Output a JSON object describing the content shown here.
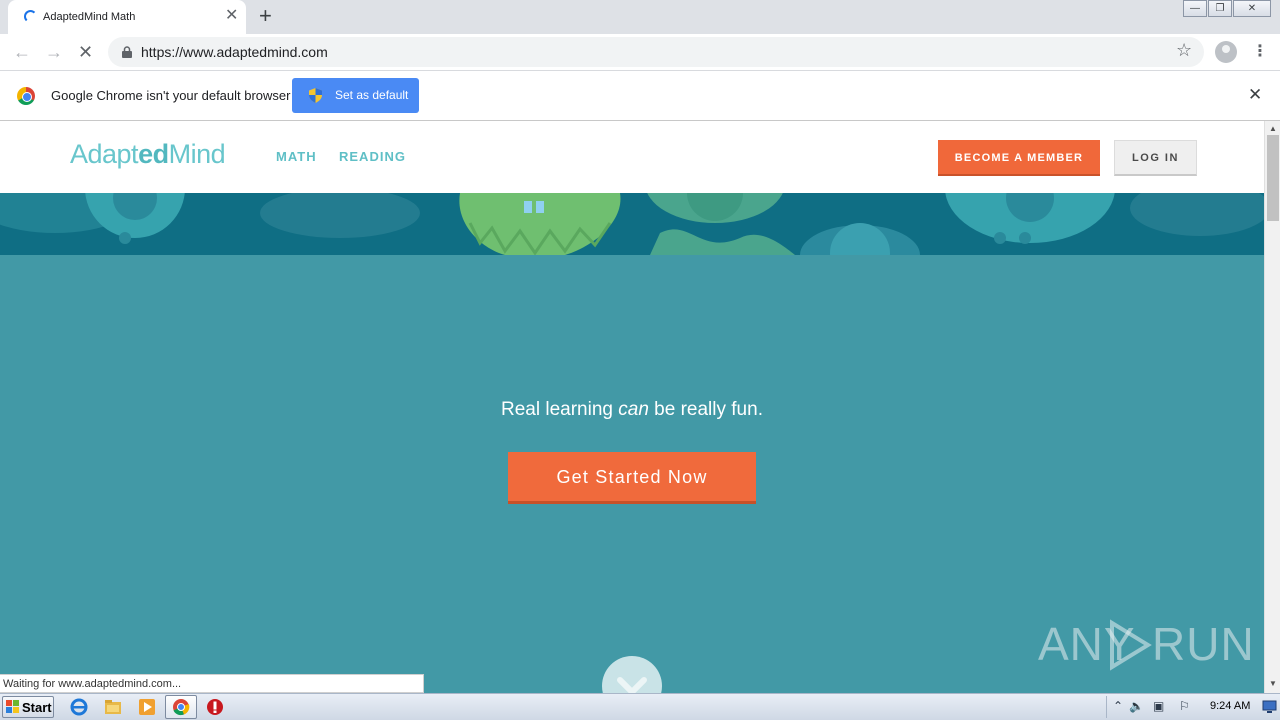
{
  "browser": {
    "tab": {
      "title": "AdaptedMind Math",
      "close_glyph": "✕"
    },
    "new_tab_glyph": "+",
    "window_controls": {
      "minimize": "—",
      "restore": "❐",
      "close": "✕"
    },
    "address": {
      "url": "https://www.adaptedmind.com"
    },
    "nav_glyphs": {
      "back": "←",
      "forward": "→",
      "stop": "✕",
      "star": "☆",
      "menu": "⋮"
    },
    "infobar": {
      "message": "Google Chrome isn't your default browser",
      "button_label": "Set as default",
      "close_glyph": "✕"
    },
    "status_text": "Waiting for www.adaptedmind.com..."
  },
  "site": {
    "logo": {
      "part1": "Adapt",
      "part2": "ed",
      "part3": "Mind"
    },
    "nav": {
      "math": "MATH",
      "reading": "READING"
    },
    "become_member": "BECOME A MEMBER",
    "log_in": "LOG IN",
    "tagline": {
      "before": "Real learning ",
      "emphasis": "can",
      "after": " be really fun."
    },
    "cta": "Get Started Now",
    "colors": {
      "accent_orange": "#f06a3c",
      "teal": "#4299a6",
      "logo_teal": "#68c6cc"
    }
  },
  "watermark": {
    "left": "ANY",
    "right": "RUN"
  },
  "taskbar": {
    "start_label": "Start",
    "clock": "9:24 AM",
    "icons": [
      "internet-explorer-icon",
      "file-explorer-icon",
      "media-player-icon",
      "chrome-icon",
      "antivirus-icon"
    ]
  }
}
